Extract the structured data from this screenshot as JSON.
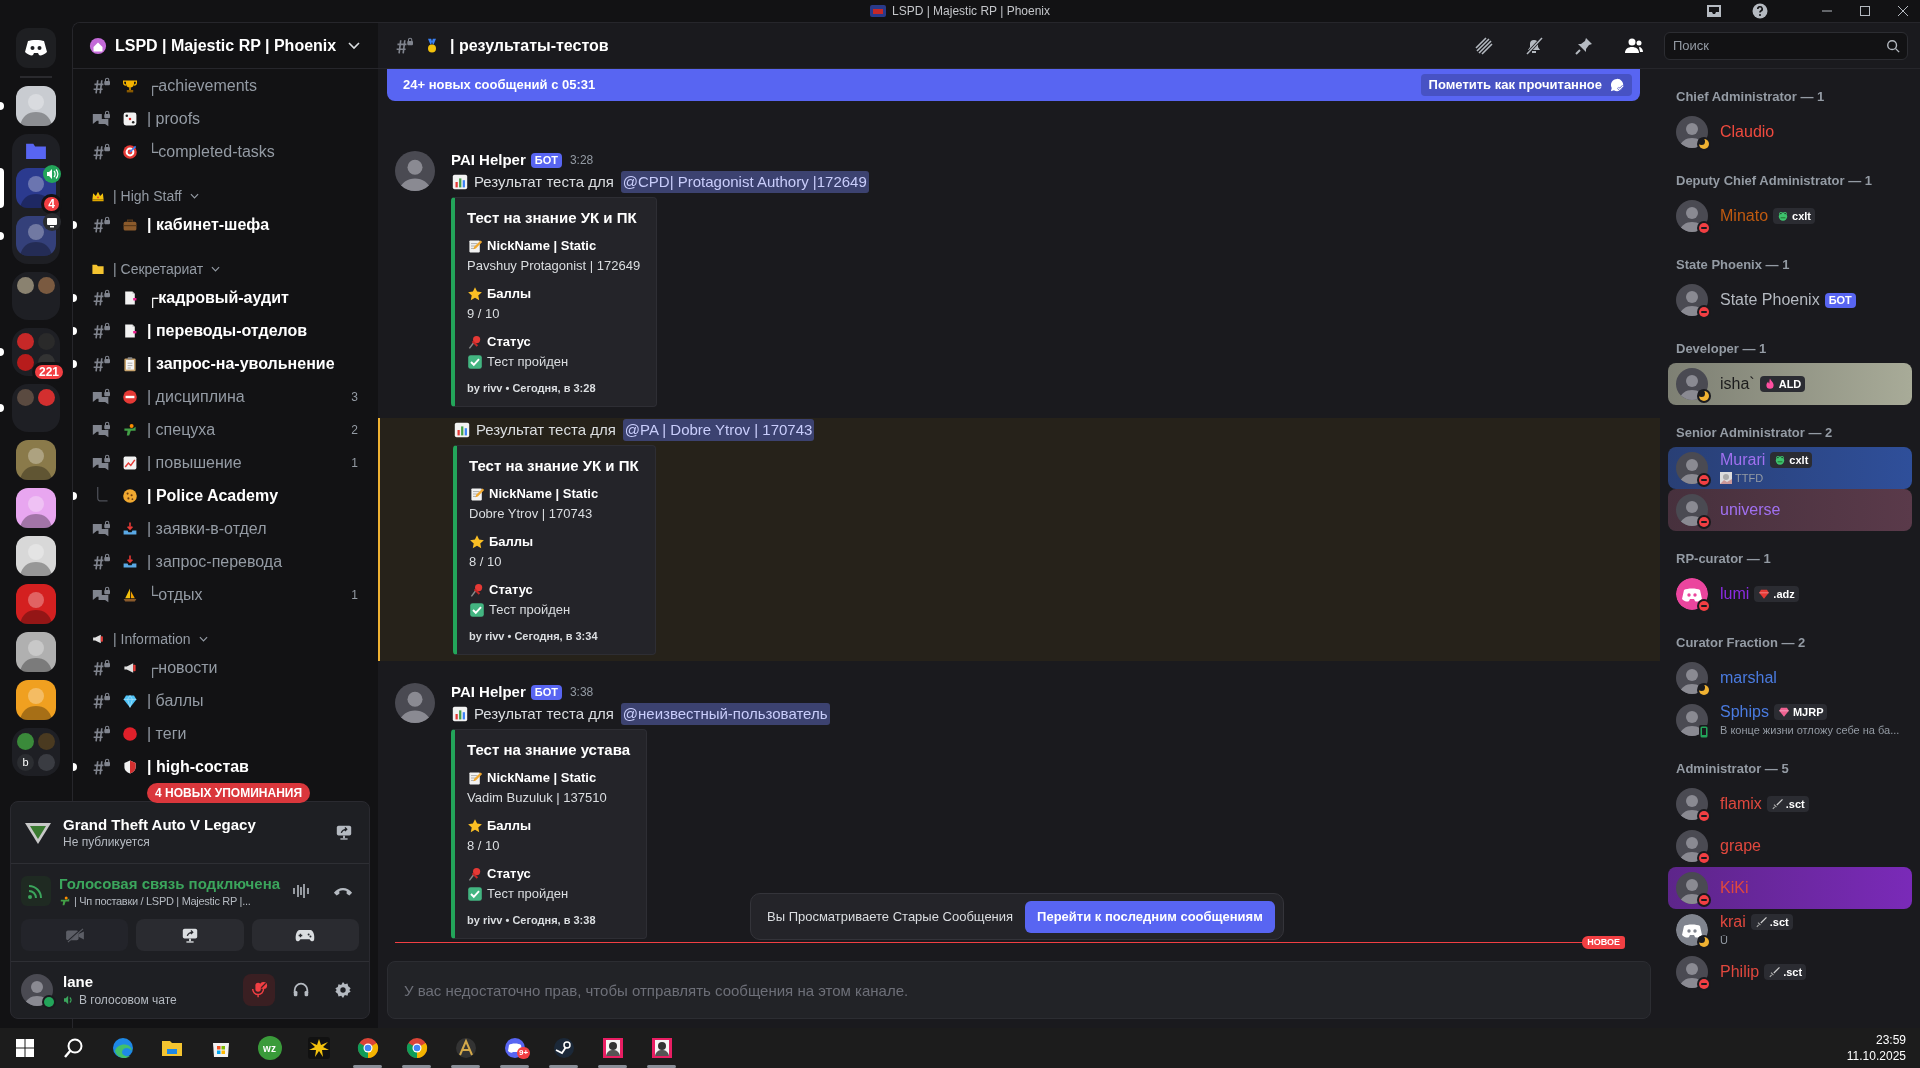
{
  "window": {
    "title": "LSPD | Majestic RP | Phoenix"
  },
  "servers": [
    {
      "kind": "home",
      "unread": false,
      "selected": false
    },
    {
      "kind": "server",
      "color": "#c9ccd1",
      "unread": true,
      "selected": false
    },
    {
      "kind": "folder-open",
      "color": "#5865f2",
      "children": [
        {
          "color": "#2b3a8f",
          "selected": true,
          "badge": "4",
          "overlay": {
            "kind": "speaker"
          }
        },
        {
          "color": "#34407a",
          "unread": true,
          "selected": false,
          "overlay": {
            "kind": "screen"
          }
        }
      ]
    },
    {
      "kind": "folder",
      "unread": false,
      "children": [
        {
          "color": "#8a8270"
        },
        {
          "color": "#7a5a40"
        }
      ]
    },
    {
      "kind": "folder",
      "unread": true,
      "badge": "221",
      "children": [
        {
          "color": "#c62828"
        },
        {
          "color": "#2a2a2a"
        },
        {
          "color": "#b71c1c"
        },
        {
          "color": "#333333"
        }
      ]
    },
    {
      "kind": "folder",
      "unread": true,
      "children": [
        {
          "color": "#5a4a40"
        },
        {
          "color": "#d32f2f"
        }
      ]
    },
    {
      "kind": "server",
      "color": "#8a7a4a",
      "unread": false,
      "selected": false
    },
    {
      "kind": "server",
      "color": "#e8a6f0",
      "unread": false,
      "selected": false
    },
    {
      "kind": "server",
      "color": "#d8d8d8",
      "unread": false,
      "selected": false
    },
    {
      "kind": "server",
      "color": "#d42020",
      "unread": false,
      "selected": false
    },
    {
      "kind": "server",
      "color": "#b0b0b0",
      "unread": false,
      "selected": false
    },
    {
      "kind": "server",
      "color": "#f0a020",
      "unread": false,
      "selected": false
    },
    {
      "kind": "folder",
      "unread": false,
      "children": [
        {
          "color": "#3a8a3a"
        },
        {
          "color": "#4a3a20"
        },
        {
          "color": "#2b2d31",
          "label": "b"
        },
        {
          "color": "#3a3c42"
        }
      ]
    }
  ],
  "server_header": {
    "name": "LSPD | Majestic RP | Phoenix"
  },
  "channels": [
    {
      "kind": "text",
      "emoji": {
        "kind": "trophy"
      },
      "name": "┌achievements",
      "unread": false
    },
    {
      "kind": "forum",
      "emoji": {
        "kind": "dice"
      },
      "name": "| proofs",
      "unread": false
    },
    {
      "kind": "text",
      "emoji": {
        "kind": "target"
      },
      "name": "└completed-tasks",
      "unread": false
    },
    {
      "kind": "category",
      "emoji": {
        "kind": "crown"
      },
      "name": "| High Staff",
      "expanded": true
    },
    {
      "kind": "text",
      "emoji": {
        "kind": "briefcase"
      },
      "name": "| кабинет-шефа",
      "unread": true
    },
    {
      "kind": "category",
      "emoji": {
        "kind": "folder"
      },
      "name": "| Секретариат",
      "expanded": true
    },
    {
      "kind": "text",
      "emoji": {
        "kind": "document"
      },
      "name": "┌кадровый-аудит",
      "unread": true
    },
    {
      "kind": "text",
      "emoji": {
        "kind": "document"
      },
      "name": "| переводы-отделов",
      "unread": true
    },
    {
      "kind": "text",
      "emoji": {
        "kind": "clipboard"
      },
      "name": "| запрос-на-увольнение",
      "unread": true
    },
    {
      "kind": "forum",
      "emoji": {
        "kind": "no-entry"
      },
      "name": "| дисциплина",
      "unread": false,
      "count": "3"
    },
    {
      "kind": "forum",
      "emoji": {
        "kind": "water-gun"
      },
      "name": "| спецуха",
      "unread": false,
      "count": "2"
    },
    {
      "kind": "forum",
      "emoji": {
        "kind": "chart"
      },
      "name": "| повышение",
      "unread": false,
      "count": "1"
    },
    {
      "kind": "thread",
      "emoji": {
        "kind": "cookie"
      },
      "name": "| Police Academy",
      "unread": true
    },
    {
      "kind": "forum",
      "emoji": {
        "kind": "inbox"
      },
      "name": "| заявки-в-отдел",
      "unread": false
    },
    {
      "kind": "text",
      "emoji": {
        "kind": "inbox"
      },
      "name": "| запрос-перевода",
      "unread": false
    },
    {
      "kind": "forum",
      "emoji": {
        "kind": "sailboat"
      },
      "name": "└отдых",
      "unread": false,
      "count": "1"
    },
    {
      "kind": "category",
      "emoji": {
        "kind": "megaphone"
      },
      "name": "| Information",
      "expanded": true
    },
    {
      "kind": "text",
      "emoji": {
        "kind": "megaphone"
      },
      "name": "┌новости",
      "unread": false
    },
    {
      "kind": "text",
      "emoji": {
        "kind": "gem"
      },
      "name": "| баллы",
      "unread": false
    },
    {
      "kind": "text",
      "emoji": {
        "kind": "dot"
      },
      "name": "| теги",
      "unread": false
    },
    {
      "kind": "text",
      "emoji": {
        "kind": "shield"
      },
      "name": "| high-состав",
      "unread": true
    }
  ],
  "mention_pill": "4 НОВЫХ УПОМИНАНИЯ",
  "activity": {
    "title": "Grand Theft Auto V Legacy",
    "subtitle": "Не публикуется"
  },
  "voice": {
    "status": "Голосовая связь подключена",
    "channel": "| Чп поставки / LSPD | Majestic RP |..."
  },
  "voice_buttons": [
    {
      "kind": "camera",
      "disabled": true
    },
    {
      "kind": "share-screen",
      "disabled": false
    },
    {
      "kind": "activity",
      "disabled": false
    }
  ],
  "user": {
    "name": "lane",
    "status": "В голосовом чате",
    "mic_muted": true
  },
  "channel_header": {
    "emoji": {
      "kind": "medal"
    },
    "name": "| результаты-тестов"
  },
  "search": {
    "placeholder": "Поиск"
  },
  "banner": {
    "text": "24+ новых сообщений с 05:31",
    "action": "Пометить как прочитанное"
  },
  "messages": [
    {
      "kind": "full",
      "author": "PAI Helper",
      "bot_tag": "БОТ",
      "time": "3:28",
      "highlighted": false,
      "text_emoji": {
        "kind": "bar-chart"
      },
      "text": "Результат теста для",
      "mention": "@CPD| Protagonist Authory |172649",
      "embed": {
        "title": "Тест на знание УК и ПК",
        "fields": [
          {
            "emoji": {
              "kind": "memo"
            },
            "name": "NickName | Static",
            "value": "Pavshuy Protagonist | 172649"
          },
          {
            "emoji": {
              "kind": "star"
            },
            "name": "Баллы",
            "value": "9 / 10"
          },
          {
            "emoji": {
              "kind": "pin"
            },
            "name": "Статус",
            "value": "Тест пройден",
            "value_emoji": {
              "kind": "check"
            }
          }
        ],
        "footer": "by rivv • Сегодня, в 3:28"
      }
    },
    {
      "kind": "continuation",
      "highlighted": true,
      "text_emoji": {
        "kind": "bar-chart"
      },
      "text": "Результат теста для",
      "mention": "@PA | Dobre Ytrov | 170743",
      "embed": {
        "title": "Тест на знание УК и ПК",
        "fields": [
          {
            "emoji": {
              "kind": "memo"
            },
            "name": "NickName | Static",
            "value": "Dobre Ytrov | 170743"
          },
          {
            "emoji": {
              "kind": "star"
            },
            "name": "Баллы",
            "value": "8 / 10"
          },
          {
            "emoji": {
              "kind": "pin"
            },
            "name": "Статус",
            "value": "Тест пройден",
            "value_emoji": {
              "kind": "check"
            }
          }
        ],
        "footer": "by rivv • Сегодня, в 3:34"
      }
    },
    {
      "kind": "full",
      "author": "PAI Helper",
      "bot_tag": "БОТ",
      "time": "3:38",
      "highlighted": false,
      "text_emoji": {
        "kind": "bar-chart"
      },
      "text": "Результат теста для",
      "mention": "@неизвестный-пользователь",
      "embed": {
        "title": "Тест на знание устава",
        "fields": [
          {
            "emoji": {
              "kind": "memo"
            },
            "name": "NickName | Static",
            "value": "Vadim Buzuluk | 137510"
          },
          {
            "emoji": {
              "kind": "star"
            },
            "name": "Баллы",
            "value": "8 / 10"
          },
          {
            "emoji": {
              "kind": "pin"
            },
            "name": "Статус",
            "value": "Тест пройден",
            "value_emoji": {
              "kind": "check"
            }
          }
        ],
        "footer": "by rivv • Сегодня, в 3:38"
      }
    }
  ],
  "new_divider": "НОВОЕ",
  "toast": {
    "text": "Вы Просматриваете Старые Сообщения",
    "button": "Перейти к последним сообщениям"
  },
  "composer": {
    "placeholder": "У вас недостаточно прав, чтобы отправлять сообщения на этом канале."
  },
  "member_groups": [
    {
      "title": "Chief Administrator — 1",
      "members": [
        {
          "name": "Claudio",
          "color": "#f04a3e",
          "presence": {
            "kind": "idle"
          },
          "avatar": {
            "kind": "picture"
          }
        }
      ]
    },
    {
      "title": "Deputy Chief Administrator — 1",
      "members": [
        {
          "name": "Minato",
          "color": "#c05a10",
          "presence": {
            "kind": "dnd"
          },
          "avatar": {
            "kind": "picture"
          },
          "tag": {
            "kind": "frog",
            "text": "cxlt"
          }
        }
      ]
    },
    {
      "title": "State Phoenix — 1",
      "members": [
        {
          "name": "State Phoenix",
          "color": "#b5bac1",
          "presence": {
            "kind": "dnd"
          },
          "avatar": {
            "kind": "picture"
          },
          "bot_tag": "БОТ"
        }
      ]
    },
    {
      "title": "Developer — 1",
      "members": [
        {
          "name": "isha`",
          "color": "#1c1c1c",
          "presence": {
            "kind": "idle"
          },
          "avatar": {
            "kind": "picture"
          },
          "tag": {
            "kind": "flame",
            "text": "ALD"
          },
          "nameplate": {
            "color": "#a8ab98"
          }
        }
      ]
    },
    {
      "title": "Senior Administrator — 2",
      "members": [
        {
          "name": "Murari",
          "color": "#a070f0",
          "presence": {
            "kind": "dnd"
          },
          "avatar": {
            "kind": "picture"
          },
          "tag": {
            "kind": "frog",
            "text": "cxlt"
          },
          "subtitle": "TTFD",
          "subtitle_picture": true,
          "nameplate": {
            "color": "#2f4f9a"
          }
        },
        {
          "name": "universe",
          "color": "#a070f0",
          "presence": {
            "kind": "dnd"
          },
          "avatar": {
            "kind": "picture"
          },
          "nameplate": {
            "color": "#5a3a4a"
          }
        }
      ]
    },
    {
      "title": "RP-curator — 1",
      "members": [
        {
          "name": "lumi",
          "color": "#8a2be2",
          "presence": {
            "kind": "dnd"
          },
          "avatar": {
            "kind": "default",
            "color": "#eb459e"
          },
          "tag": {
            "kind": "crystal",
            "text": ".adz"
          }
        }
      ]
    },
    {
      "title": "Curator Fraction — 2",
      "members": [
        {
          "name": "marshal",
          "color": "#4a7be0",
          "presence": {
            "kind": "idle"
          },
          "avatar": {
            "kind": "picture"
          }
        },
        {
          "name": "Sphips",
          "color": "#4a7be0",
          "presence": {
            "kind": "mobile"
          },
          "avatar": {
            "kind": "picture"
          },
          "tag": {
            "kind": "jewel",
            "text": "MJRP"
          },
          "subtitle": "В конце жизни отложу себе на ба..."
        }
      ]
    },
    {
      "title": "Administrator — 5",
      "members": [
        {
          "name": "flamix",
          "color": "#e0483e",
          "presence": {
            "kind": "dnd"
          },
          "avatar": {
            "kind": "picture"
          },
          "tag": {
            "kind": "sword",
            "text": ".sct"
          }
        },
        {
          "name": "grape",
          "color": "#e0483e",
          "presence": {
            "kind": "dnd"
          },
          "avatar": {
            "kind": "picture"
          }
        },
        {
          "name": "KiKi",
          "color": "#e0483e",
          "presence": {
            "kind": "dnd"
          },
          "avatar": {
            "kind": "picture"
          },
          "nameplate": {
            "color": "#7a2ab8"
          }
        },
        {
          "name": "krai",
          "color": "#e0483e",
          "presence": {
            "kind": "idle"
          },
          "avatar": {
            "kind": "default",
            "color": "#80848e"
          },
          "tag": {
            "kind": "sword",
            "text": ".sct"
          },
          "subtitle": "Ū"
        },
        {
          "name": "Philip",
          "color": "#e0483e",
          "presence": {
            "kind": "dnd"
          },
          "avatar": {
            "kind": "picture"
          },
          "tag": {
            "kind": "sword",
            "text": ".sct"
          }
        }
      ]
    }
  ],
  "taskbar": [
    {
      "kind": "windows",
      "open": false
    },
    {
      "kind": "search",
      "open": false
    },
    {
      "kind": "edge",
      "open": false
    },
    {
      "kind": "files",
      "open": false
    },
    {
      "kind": "store",
      "open": false
    },
    {
      "kind": "wz",
      "label": "wz",
      "open": false
    },
    {
      "kind": "burst",
      "open": false
    },
    {
      "kind": "chrome",
      "open": true
    },
    {
      "kind": "chrome",
      "open": true
    },
    {
      "kind": "anarchy",
      "open": true
    },
    {
      "kind": "discord",
      "open": true,
      "badge": "9+"
    },
    {
      "kind": "steam",
      "open": true
    },
    {
      "kind": "picture",
      "open": true
    },
    {
      "kind": "picture",
      "open": true
    }
  ],
  "clock": {
    "time": "23:59",
    "date": "11.10.2025"
  }
}
